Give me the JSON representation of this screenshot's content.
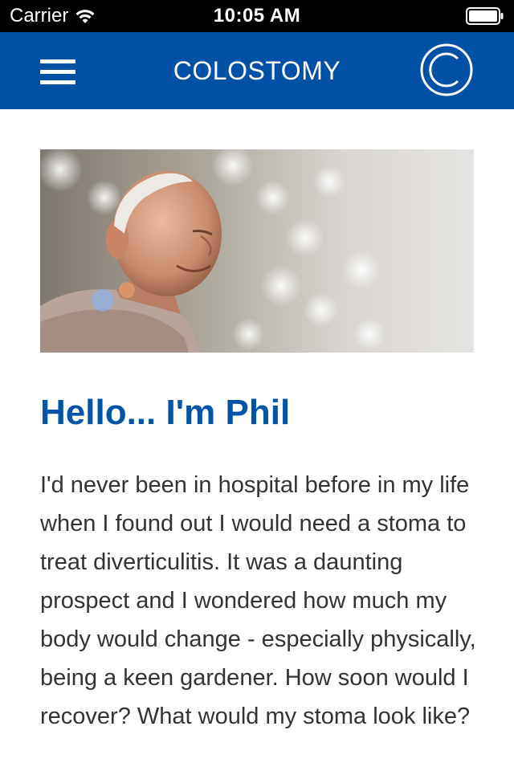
{
  "status_bar": {
    "carrier": "Carrier",
    "time": "10:05 AM",
    "wifi_icon": "wifi-icon",
    "battery_icon": "battery-full-icon"
  },
  "nav_bar": {
    "title": "COLOSTOMY",
    "menu_icon": "hamburger-menu-icon",
    "logo_icon": "circle-c-logo-icon",
    "background_color": "#0050a6"
  },
  "content": {
    "image_description_icon": "portrait-photo",
    "heading": "Hello... I'm Phil",
    "heading_color": "#0055a8",
    "paragraph": "I'd never been in hospital before in my life when I found out I would need a stoma to treat diverticulitis. It was a daunting prospect and I wondered how much my body would change - especially physically, being a keen gardener. How soon would I recover? What would my stoma look like?"
  }
}
